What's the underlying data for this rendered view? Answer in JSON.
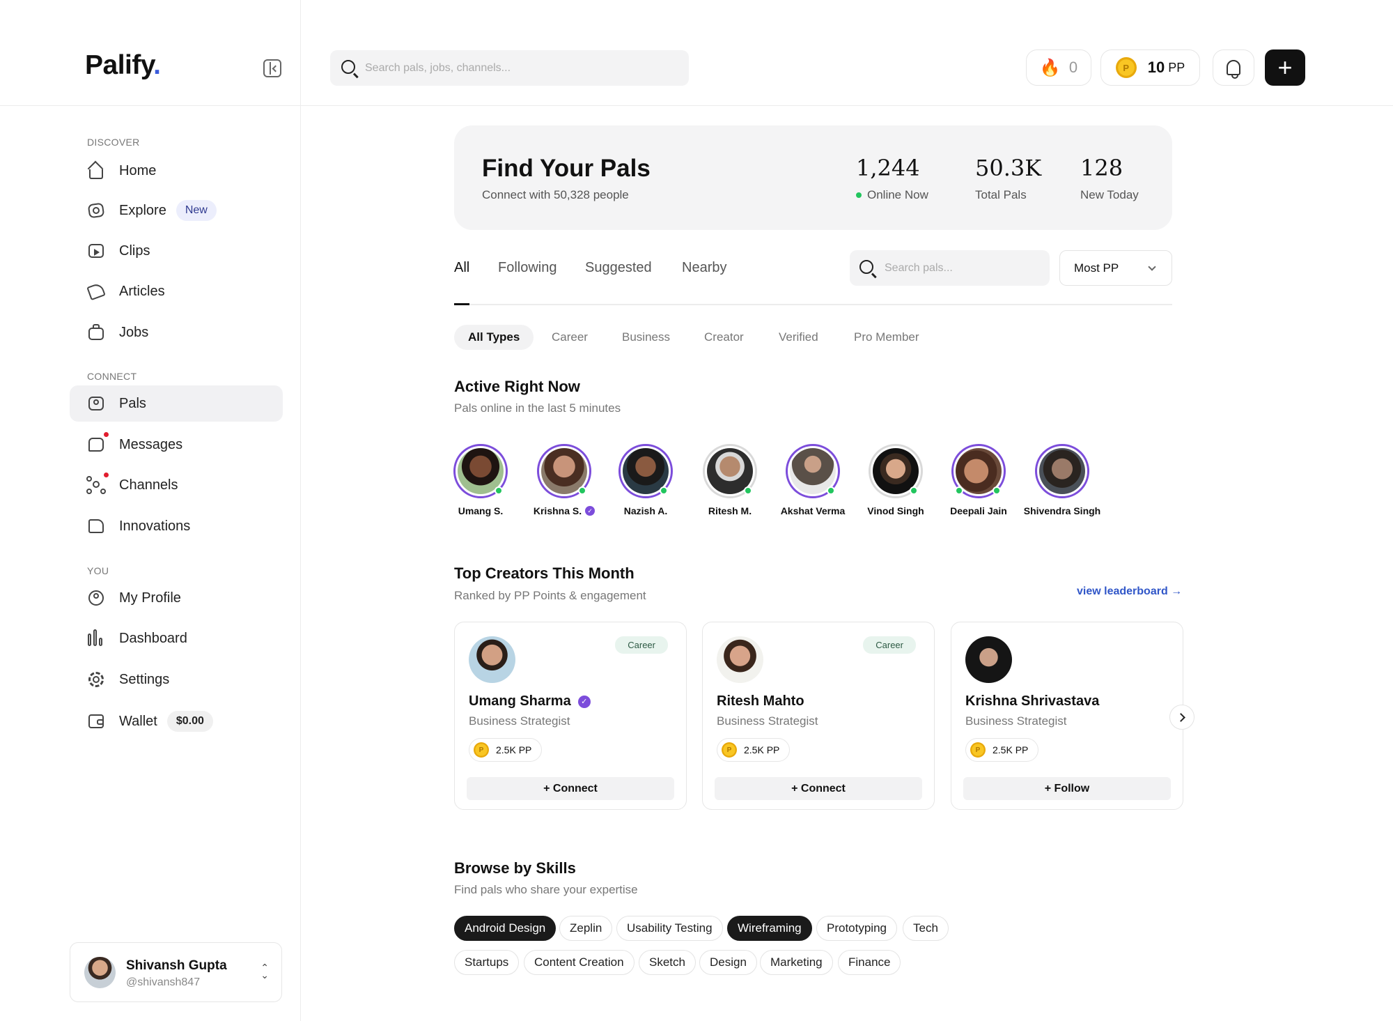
{
  "app": {
    "logo": "Palify",
    "logo_dot": "."
  },
  "sidebar": {
    "sections": {
      "discover": "DISCOVER",
      "connect": "CONNECT",
      "you": "YOU"
    },
    "items": [
      {
        "label": "Home",
        "icon": "home-icon"
      },
      {
        "label": "Explore",
        "icon": "compass-icon",
        "badge": "New"
      },
      {
        "label": "Clips",
        "icon": "clips-icon"
      },
      {
        "label": "Articles",
        "icon": "articles-icon"
      },
      {
        "label": "Jobs",
        "icon": "briefcase-icon"
      },
      {
        "label": "Pals",
        "icon": "user-square-icon",
        "active": true
      },
      {
        "label": "Messages",
        "icon": "message-icon",
        "unread": true
      },
      {
        "label": "Channels",
        "icon": "channels-icon",
        "unread": true
      },
      {
        "label": "Innovations",
        "icon": "folder-icon"
      },
      {
        "label": "My Profile",
        "icon": "user-circle-icon"
      },
      {
        "label": "Dashboard",
        "icon": "bar-chart-icon"
      },
      {
        "label": "Settings",
        "icon": "gear-icon"
      },
      {
        "label": "Wallet",
        "icon": "wallet-icon",
        "badge": "$0.00"
      }
    ],
    "user": {
      "name": "Shivansh Gupta",
      "handle": "@shivansh847"
    }
  },
  "topbar": {
    "search_placeholder": "Search pals, jobs, channels...",
    "streak": "0",
    "points_value": "10",
    "points_unit": "PP",
    "coin_symbol": "P"
  },
  "hero": {
    "title": "Find Your Pals",
    "subtitle": "Connect with 50,328 people",
    "stats": [
      {
        "value": "1,244",
        "label": "Online Now"
      },
      {
        "value": "50.3K",
        "label": "Total Pals"
      },
      {
        "value": "128",
        "label": "New Today"
      }
    ]
  },
  "tabs": [
    "All",
    "Following",
    "Suggested",
    "Nearby"
  ],
  "pals_search_placeholder": "Search pals...",
  "sort": {
    "selected": "Most PP"
  },
  "type_filters": [
    "All Types",
    "Career",
    "Business",
    "Creator",
    "Verified",
    "Pro Member"
  ],
  "active_now": {
    "title": "Active Right Now",
    "subtitle": "Pals online in the last 5 minutes",
    "pals": [
      {
        "name": "Umang S.",
        "online": true
      },
      {
        "name": "Krishna S.",
        "online": true,
        "verified": true
      },
      {
        "name": "Nazish A.",
        "online": true
      },
      {
        "name": "Ritesh M.",
        "online": true
      },
      {
        "name": "Akshat Verma",
        "online": true
      },
      {
        "name": "Vinod Singh",
        "online": true
      },
      {
        "name": "Deepali Jain",
        "online": true
      },
      {
        "name": "Shivendra Singh",
        "online": false
      }
    ]
  },
  "top_creators": {
    "title": "Top Creators This Month",
    "subtitle": "Ranked by PP Points & engagement",
    "link": "view leaderboard →",
    "cards": [
      {
        "name": "Umang Sharma",
        "verified": true,
        "role": "Business Strategist",
        "tag": "Career",
        "pp": "2.5K PP",
        "action": "+ Connect"
      },
      {
        "name": "Ritesh Mahto",
        "verified": false,
        "role": "Business Strategist",
        "tag": "Career",
        "pp": "2.5K PP",
        "action": "+ Connect"
      },
      {
        "name": "Krishna Shrivastava",
        "verified": false,
        "role": "Business Strategist",
        "tag": "",
        "pp": "2.5K PP",
        "action": "+ Follow"
      }
    ]
  },
  "skills": {
    "title": "Browse by Skills",
    "subtitle": "Find pals who share your expertise",
    "items": [
      {
        "label": "Android Design",
        "active": true
      },
      {
        "label": "Zeplin"
      },
      {
        "label": "Usability Testing"
      },
      {
        "label": "Wireframing",
        "active": true
      },
      {
        "label": "Prototyping"
      },
      {
        "label": "Tech"
      },
      {
        "label": "Startups"
      },
      {
        "label": "Content Creation"
      },
      {
        "label": "Sketch"
      },
      {
        "label": "Design"
      },
      {
        "label": "Marketing"
      },
      {
        "label": "Finance"
      }
    ]
  },
  "colors": {
    "accent": "#7c4ddb",
    "online": "#22c55e",
    "link": "#3056c8",
    "primary_button": "#111111"
  }
}
